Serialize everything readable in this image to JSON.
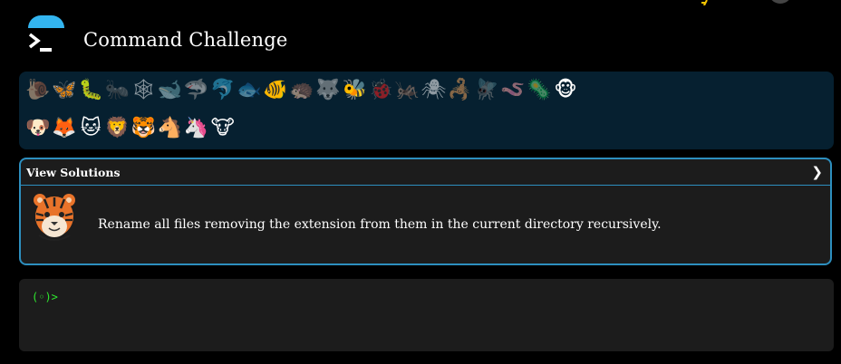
{
  "app": {
    "title": "Command Challenge"
  },
  "levels": [
    {
      "emoji": "🐌",
      "icon": "snail-icon",
      "completed": false
    },
    {
      "emoji": "🦋",
      "icon": "butterfly-icon",
      "completed": true
    },
    {
      "emoji": "🐛",
      "icon": "caterpillar-icon",
      "completed": true
    },
    {
      "emoji": "🐜",
      "icon": "ant-icon",
      "completed": false
    },
    {
      "emoji": "🕸",
      "icon": "spider-web-icon",
      "completed": false
    },
    {
      "emoji": "🐋",
      "icon": "whale-icon",
      "completed": false
    },
    {
      "emoji": "🦈",
      "icon": "shark-icon",
      "completed": false
    },
    {
      "emoji": "🐬",
      "icon": "dolphin-icon",
      "completed": false
    },
    {
      "emoji": "🐟",
      "icon": "fish-icon",
      "completed": false
    },
    {
      "emoji": "🐠",
      "icon": "tropical-fish-icon",
      "completed": true
    },
    {
      "emoji": "🦔",
      "icon": "hedgehog-icon",
      "completed": false
    },
    {
      "emoji": "🐺",
      "icon": "wolf-icon",
      "completed": false
    },
    {
      "emoji": "🐝",
      "icon": "bee-icon",
      "completed": true
    },
    {
      "emoji": "🐞",
      "icon": "ladybug-icon",
      "completed": false
    },
    {
      "emoji": "🦗",
      "icon": "cricket-icon",
      "completed": false
    },
    {
      "emoji": "🕷",
      "icon": "spider-icon",
      "completed": false
    },
    {
      "emoji": "🦂",
      "icon": "scorpion-icon",
      "completed": false
    },
    {
      "emoji": "🪰",
      "icon": "fly-icon",
      "completed": false
    },
    {
      "emoji": "🪱",
      "icon": "worm-icon",
      "completed": false
    },
    {
      "emoji": "🦠",
      "icon": "microbe-icon",
      "completed": false
    },
    {
      "emoji": "🐵",
      "icon": "monkey-icon",
      "completed": true
    },
    {
      "emoji": "🐶",
      "icon": "dog-icon",
      "completed": true
    },
    {
      "emoji": "🦊",
      "icon": "fox-icon",
      "completed": true
    },
    {
      "emoji": "🐱",
      "icon": "cat-icon",
      "completed": true
    },
    {
      "emoji": "🦁",
      "icon": "lion-icon",
      "completed": true
    },
    {
      "emoji": "🐯",
      "icon": "tiger-icon",
      "completed": true
    },
    {
      "emoji": "🐴",
      "icon": "horse-icon",
      "completed": true
    },
    {
      "emoji": "🦄",
      "icon": "unicorn-icon",
      "completed": true
    },
    {
      "emoji": "🐮",
      "icon": "cow-icon",
      "completed": true
    }
  ],
  "challenge": {
    "view_solutions_label": "View Solutions",
    "chevron": "❯",
    "avatar_emoji": "🐯",
    "description": "Rename all files removing the extension from them in the current directory recursively."
  },
  "terminal": {
    "prompt": "(◦)>"
  }
}
